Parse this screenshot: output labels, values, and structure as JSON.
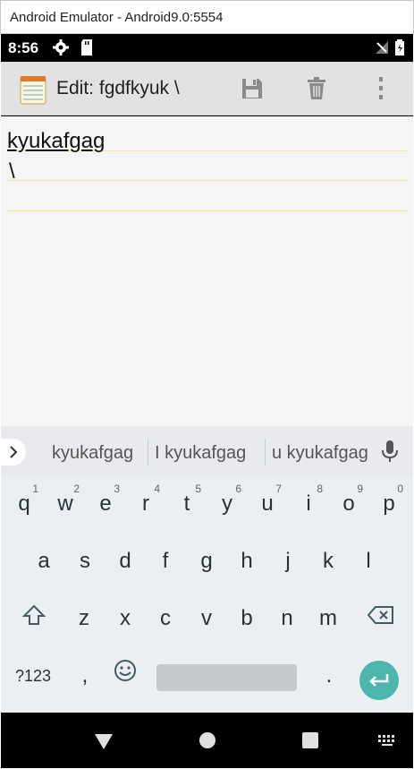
{
  "window": {
    "title": "Android Emulator - Android9.0:5554"
  },
  "status_bar": {
    "time": "8:56"
  },
  "toolbar": {
    "title": "Edit: fgdfkyuk \\"
  },
  "editor": {
    "lines": [
      "kyukafgag",
      "\\"
    ]
  },
  "suggestions": [
    "kyukafgag",
    "I kyukafgag",
    "u kyukafgag"
  ],
  "keyboard": {
    "row1": [
      {
        "key": "q",
        "num": "1"
      },
      {
        "key": "w",
        "num": "2"
      },
      {
        "key": "e",
        "num": "3"
      },
      {
        "key": "r",
        "num": "4"
      },
      {
        "key": "t",
        "num": "5"
      },
      {
        "key": "y",
        "num": "6"
      },
      {
        "key": "u",
        "num": "7"
      },
      {
        "key": "i",
        "num": "8"
      },
      {
        "key": "o",
        "num": "9"
      },
      {
        "key": "p",
        "num": "0"
      }
    ],
    "row2": [
      "a",
      "s",
      "d",
      "f",
      "g",
      "h",
      "j",
      "k",
      "l"
    ],
    "row3": [
      "z",
      "x",
      "c",
      "v",
      "b",
      "n",
      "m"
    ],
    "symbols_label": "?123",
    "comma_label": ",",
    "period_label": "."
  },
  "colors": {
    "toolbar": "#e2e2e2",
    "accent_enter": "#4db6ac",
    "note_lines": "#f1ec9a"
  }
}
